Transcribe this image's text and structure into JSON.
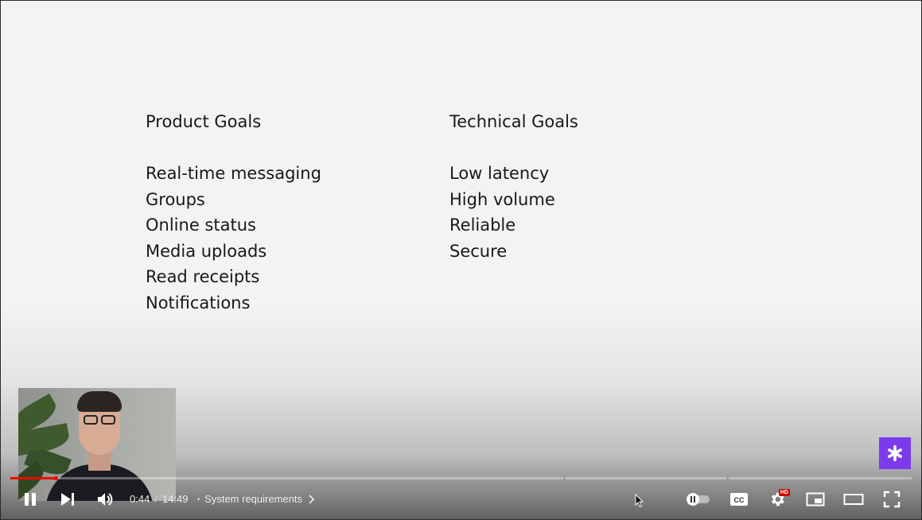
{
  "slide": {
    "product": {
      "heading": "Product Goals",
      "items": [
        "Real-time messaging",
        "Groups",
        "Online status",
        "Media uploads",
        "Read receipts",
        "Notifications"
      ]
    },
    "technical": {
      "heading": "Technical Goals",
      "items": [
        "Low latency",
        "High volume",
        "Reliable",
        "Secure"
      ]
    }
  },
  "player": {
    "time_current": "0:44",
    "time_separator": "/",
    "time_total": "14:49",
    "chapter_separator": "•",
    "chapter_title": "System requirements",
    "progress_played_fraction": 0.05,
    "hd_badge": "HD",
    "accent_color": "#ff0000",
    "icons": [
      "pause-icon",
      "next-icon",
      "volume-icon",
      "chevron-right-icon",
      "autoplay-toggle-icon",
      "captions-icon",
      "settings-icon",
      "miniplayer-icon",
      "theater-mode-icon",
      "fullscreen-icon",
      "star-icon",
      "mouse-cursor-icon"
    ]
  },
  "overlay": {
    "star_button_color": "#7c3aed"
  }
}
